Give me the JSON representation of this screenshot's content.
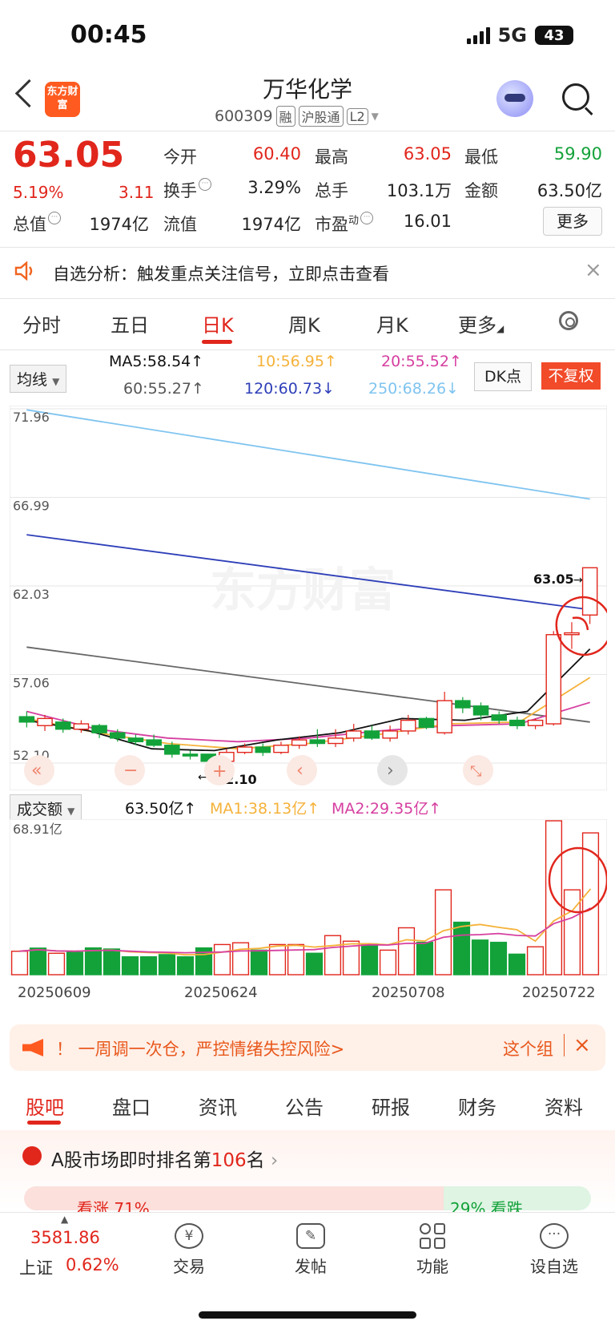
{
  "status": {
    "time": "00:45",
    "network": "5G",
    "battery": "43"
  },
  "header": {
    "logo_text": "东方财富",
    "stock_name": "万华化学",
    "code": "600309",
    "tags": [
      "融",
      "沪股通",
      "L2"
    ]
  },
  "quote": {
    "price": "63.05",
    "change_pct": "5.19%",
    "change": "3.11",
    "open_label": "今开",
    "open": "60.40",
    "high_label": "最高",
    "high": "63.05",
    "low_label": "最低",
    "low": "59.90",
    "turnover_label": "换手",
    "turnover": "3.29%",
    "volume_label": "总手",
    "volume": "103.1万",
    "amount_label": "金额",
    "amount": "63.50亿",
    "mktcap_label": "总值",
    "mktcap": "1974亿",
    "float_label": "流值",
    "float_cap": "1974亿",
    "pe_label": "市盈",
    "pe_sup": "动",
    "pe": "16.01",
    "more": "更多"
  },
  "banner": {
    "text": "自选分析：触发重点关注信号，立即点击查看",
    "close": "×"
  },
  "tabs": [
    "分时",
    "五日",
    "日K",
    "周K",
    "月K",
    "更多"
  ],
  "ma_legend": {
    "selector": "均线",
    "ma5": "MA5:58.54↑",
    "ma10": "10:56.95↑",
    "ma20": "20:55.52↑",
    "ma60": "60:55.27↑",
    "ma120": "120:60.73↓",
    "ma250": "250:68.26↓",
    "dk": "DK点",
    "fq": "不复权"
  },
  "vol_legend": {
    "selector": "成交额",
    "value": "63.50亿↑",
    "ma1": "MA1:38.13亿↑",
    "ma2": "MA2:29.35亿↑"
  },
  "chart_data": [
    {
      "type": "candlestick",
      "y_ticks": [
        "71.96",
        "66.99",
        "62.03",
        "57.06",
        "52.10"
      ],
      "ylim": [
        52.1,
        71.96
      ],
      "low_marker": "52.10",
      "high_marker": "63.05",
      "watermark": "东方财富",
      "candles": [
        {
          "o": 54.7,
          "c": 54.4,
          "h": 55.0,
          "l": 54.1
        },
        {
          "o": 54.2,
          "c": 54.6,
          "h": 54.8,
          "l": 53.9
        },
        {
          "o": 54.4,
          "c": 54.0,
          "h": 54.6,
          "l": 53.8
        },
        {
          "o": 54.0,
          "c": 54.3,
          "h": 54.5,
          "l": 53.8
        },
        {
          "o": 54.2,
          "c": 53.8,
          "h": 54.3,
          "l": 53.5
        },
        {
          "o": 53.8,
          "c": 53.5,
          "h": 54.0,
          "l": 53.3
        },
        {
          "o": 53.5,
          "c": 53.3,
          "h": 53.7,
          "l": 53.1
        },
        {
          "o": 53.4,
          "c": 53.1,
          "h": 53.7,
          "l": 53.0
        },
        {
          "o": 53.1,
          "c": 52.6,
          "h": 53.3,
          "l": 52.4
        },
        {
          "o": 52.6,
          "c": 52.5,
          "h": 52.8,
          "l": 52.3
        },
        {
          "o": 52.6,
          "c": 52.2,
          "h": 52.6,
          "l": 52.1
        },
        {
          "o": 52.2,
          "c": 52.7,
          "h": 52.9,
          "l": 52.1
        },
        {
          "o": 52.7,
          "c": 53.0,
          "h": 53.2,
          "l": 52.6
        },
        {
          "o": 53.0,
          "c": 52.7,
          "h": 53.2,
          "l": 52.5
        },
        {
          "o": 52.7,
          "c": 53.1,
          "h": 53.3,
          "l": 52.6
        },
        {
          "o": 53.1,
          "c": 53.4,
          "h": 53.6,
          "l": 52.9
        },
        {
          "o": 53.4,
          "c": 53.2,
          "h": 54.0,
          "l": 53.0
        },
        {
          "o": 53.2,
          "c": 53.5,
          "h": 54.0,
          "l": 53.0
        },
        {
          "o": 53.5,
          "c": 53.9,
          "h": 54.3,
          "l": 53.3
        },
        {
          "o": 53.9,
          "c": 53.5,
          "h": 54.2,
          "l": 53.4
        },
        {
          "o": 53.5,
          "c": 53.9,
          "h": 54.2,
          "l": 53.3
        },
        {
          "o": 53.9,
          "c": 54.5,
          "h": 54.8,
          "l": 53.7
        },
        {
          "o": 54.6,
          "c": 54.1,
          "h": 54.7,
          "l": 54.0
        },
        {
          "o": 53.8,
          "c": 55.6,
          "h": 56.1,
          "l": 53.7
        },
        {
          "o": 55.6,
          "c": 55.2,
          "h": 55.8,
          "l": 54.9
        },
        {
          "o": 55.3,
          "c": 54.8,
          "h": 55.5,
          "l": 54.5
        },
        {
          "o": 54.8,
          "c": 54.5,
          "h": 55.0,
          "l": 54.3
        },
        {
          "o": 54.5,
          "c": 54.2,
          "h": 54.7,
          "l": 54.0
        },
        {
          "o": 54.2,
          "c": 54.5,
          "h": 54.6,
          "l": 54.0
        },
        {
          "o": 54.3,
          "c": 59.3,
          "h": 59.5,
          "l": 54.2
        },
        {
          "o": 59.3,
          "c": 59.4,
          "h": 60.0,
          "l": 58.5
        },
        {
          "o": 60.4,
          "c": 63.05,
          "h": 63.05,
          "l": 59.9
        }
      ],
      "ma_lines": [
        {
          "name": "MA250",
          "color": "#7fc4f0",
          "values": [
            71.9,
            66.9
          ]
        },
        {
          "name": "MA120",
          "color": "#2e3fb8",
          "values": [
            64.9,
            60.7
          ]
        },
        {
          "name": "MA60",
          "color": "#666666",
          "values": [
            58.6,
            54.4
          ]
        },
        {
          "name": "MA20",
          "color": "#d63fa0",
          "values": [
            55.0,
            54.0,
            53.5,
            53.3,
            53.5,
            53.9,
            54.2,
            54.3,
            55.5
          ]
        },
        {
          "name": "MA10",
          "color": "#f5b23a",
          "values": [
            54.6,
            53.8,
            53.2,
            52.9,
            53.2,
            53.7,
            54.3,
            54.4,
            56.9
          ]
        },
        {
          "name": "MA5",
          "color": "#111111",
          "values": [
            54.5,
            53.9,
            52.9,
            52.8,
            53.4,
            53.8,
            54.6,
            54.5,
            55.0,
            58.5
          ]
        }
      ]
    },
    {
      "type": "bar",
      "y_top_label": "68.91亿",
      "ymax": 68.91,
      "x_ticks": [
        "20250609",
        "20250624",
        "20250708",
        "20250722"
      ],
      "bars": [
        {
          "v": 10.5,
          "up": true
        },
        {
          "v": 11.9,
          "up": false
        },
        {
          "v": 9.6,
          "up": true
        },
        {
          "v": 10.0,
          "up": false
        },
        {
          "v": 12.0,
          "up": false
        },
        {
          "v": 11.5,
          "up": false
        },
        {
          "v": 8.0,
          "up": false
        },
        {
          "v": 8.0,
          "up": false
        },
        {
          "v": 9.0,
          "up": false
        },
        {
          "v": 8.0,
          "up": false
        },
        {
          "v": 12.0,
          "up": false
        },
        {
          "v": 13.5,
          "up": true
        },
        {
          "v": 14.3,
          "up": true
        },
        {
          "v": 11.0,
          "up": false
        },
        {
          "v": 13.5,
          "up": true
        },
        {
          "v": 13.5,
          "up": true
        },
        {
          "v": 9.6,
          "up": false
        },
        {
          "v": 17.5,
          "up": true
        },
        {
          "v": 15.0,
          "up": true
        },
        {
          "v": 13.8,
          "up": false
        },
        {
          "v": 11.0,
          "up": true
        },
        {
          "v": 21.0,
          "up": true
        },
        {
          "v": 14.5,
          "up": false
        },
        {
          "v": 38.0,
          "up": true
        },
        {
          "v": 23.5,
          "up": false
        },
        {
          "v": 15.5,
          "up": false
        },
        {
          "v": 14.5,
          "up": false
        },
        {
          "v": 9.2,
          "up": false
        },
        {
          "v": 12.5,
          "up": true
        },
        {
          "v": 68.91,
          "up": true
        },
        {
          "v": 38.0,
          "up": true
        },
        {
          "v": 63.5,
          "up": true
        }
      ]
    }
  ],
  "warn": {
    "text": "！ 一周调一次仓，严控情绪失控风险>",
    "right": "这个组",
    "close": "×"
  },
  "bottom_tabs": [
    "股吧",
    "盘口",
    "资讯",
    "公告",
    "研报",
    "财务",
    "资料"
  ],
  "rank": {
    "prefix": "A股市场即时排名第",
    "num": "106",
    "suffix": "名",
    "arrow": "›"
  },
  "vote": {
    "left": "看涨 71%",
    "right": "29% 看跌"
  },
  "nav": {
    "index_value": "3581.86",
    "index_name": "上证",
    "index_pct": "0.62%",
    "items": [
      "交易",
      "发帖",
      "功能",
      "设自选"
    ]
  }
}
